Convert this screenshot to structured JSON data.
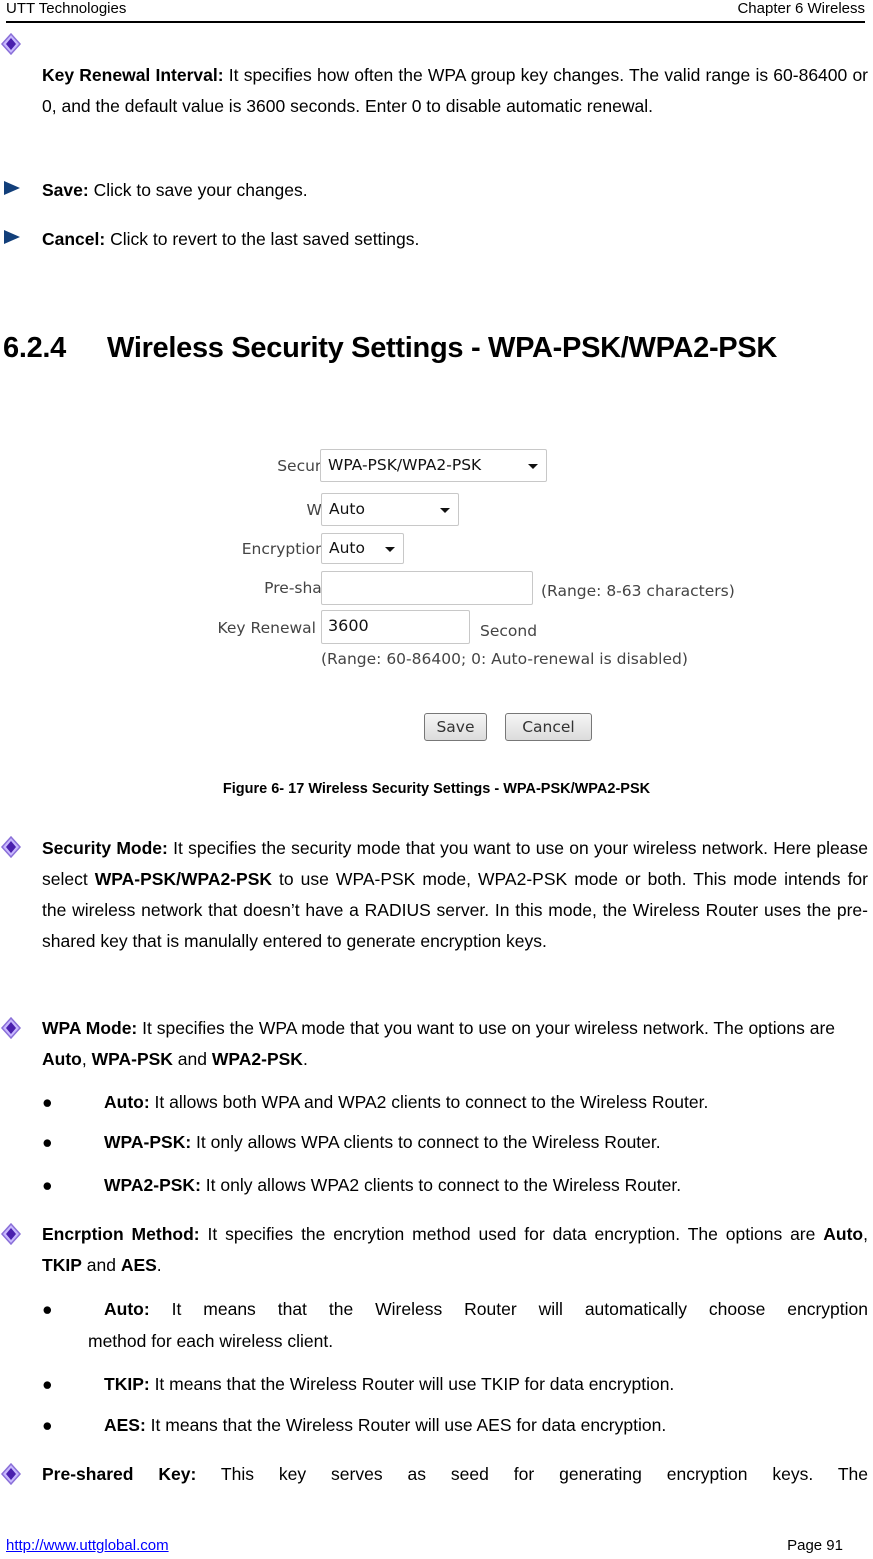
{
  "header": {
    "left": "UTT Technologies",
    "right": "Chapter 6 Wireless"
  },
  "intro": {
    "key_renewal": {
      "term": "Key Renewal Interval:",
      "text": " It specifies how often the WPA group key changes. The valid range is 60-86400 or 0, and the default value is 3600 seconds. Enter 0 to disable automatic renewal."
    },
    "save": {
      "term": "Save:",
      "text": " Click to save your changes."
    },
    "cancel": {
      "term": "Cancel:",
      "text": " Click to revert to the last saved settings."
    }
  },
  "section": {
    "number": "6.2.4",
    "title": "Wireless Security Settings - WPA-PSK/WPA2-PSK"
  },
  "figure": {
    "security_mode": {
      "label": "Security Mode",
      "value": "WPA-PSK/WPA2-PSK"
    },
    "wpa_mode": {
      "label": "WPA Mode",
      "value": "Auto"
    },
    "encryption_method": {
      "label": "Encryption Method",
      "value": "Auto"
    },
    "pre_shared_key": {
      "label": "Pre-shared Key",
      "required": "*",
      "value": "",
      "hint": "(Range: 8-63 characters)"
    },
    "key_renewal": {
      "label": "Key Renewal Interval",
      "required": "*",
      "value": "3600",
      "unit": "Second",
      "hint": "(Range: 60-86400; 0: Auto-renewal is disabled)"
    },
    "save_label": "Save",
    "cancel_label": "Cancel",
    "caption": "Figure 6- 17 Wireless Security Settings - WPA-PSK/WPA2-PSK"
  },
  "security_mode": {
    "term": "Security Mode:",
    "t1": " It specifies the security mode that you want to use on your wireless network. Here please select ",
    "b1": "WPA-PSK/WPA2-PSK",
    "t2": " to use WPA-PSK mode, WPA2-PSK mode or both. This mode intends for the wireless network that doesn’t have a RADIUS server. In this mode, the Wireless Router uses the pre-shared key that is manulally entered to generate encryption keys."
  },
  "wpa_mode": {
    "term": "WPA Mode:",
    "t1": " It specifies the WPA mode that you want to use on your wireless network. The options are ",
    "o1": "Auto",
    "sep1": ", ",
    "o2": "WPA-PSK",
    "sep2": " and ",
    "o3": "WPA2-PSK",
    "end": ".",
    "bullets": [
      {
        "term": "Auto:",
        "text": " It allows both WPA and WPA2 clients to connect to the Wireless Router."
      },
      {
        "term": "WPA-PSK:",
        "text": " It only allows WPA clients to connect to the Wireless Router."
      },
      {
        "term": "WPA2-PSK:",
        "text": " It only allows WPA2 clients to connect to the Wireless Router."
      }
    ]
  },
  "encryption": {
    "term": "Encrption Method:",
    "t1": " It specifies the encrytion method used for data encryption. The options are ",
    "o1": "Auto",
    "sep1": ", ",
    "o2": "TKIP",
    "sep2": " and ",
    "o3": "AES",
    "end": ".",
    "bullets": [
      {
        "term": "Auto:",
        "text": " It means that the Wireless Router will automatically choose encryption",
        "cont": "method for each wireless client."
      },
      {
        "term": "TKIP:",
        "text": " It means that the Wireless Router will use TKIP for data encryption."
      },
      {
        "term": "AES:",
        "text": " It means that the Wireless Router will use AES for data encryption."
      }
    ]
  },
  "pre_shared": {
    "term": "Pre-shared Key:",
    "text": " This key serves as seed for generating encryption keys. The"
  },
  "bullet_glyph": "●",
  "footer": {
    "url": "http://www.uttglobal.com",
    "page": "Page 91"
  }
}
